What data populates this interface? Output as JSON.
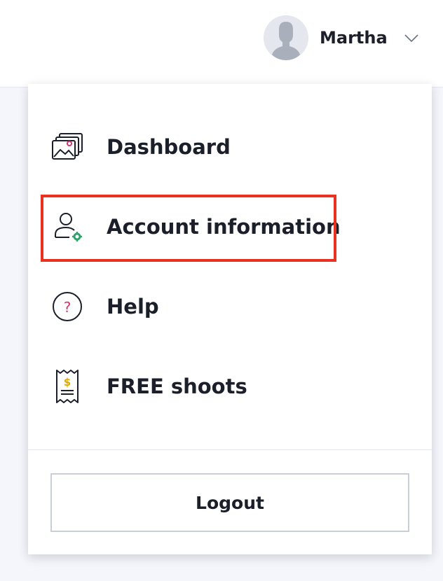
{
  "header": {
    "user_name": "Martha",
    "avatar_icon": "user-avatar-icon",
    "dropdown_icon": "chevron-down-icon"
  },
  "menu": {
    "items": [
      {
        "label": "Dashboard",
        "icon": "images-gallery-icon",
        "highlighted": false
      },
      {
        "label": "Account information",
        "icon": "user-settings-icon",
        "highlighted": true
      },
      {
        "label": "Help",
        "icon": "question-circle-icon",
        "highlighted": false
      },
      {
        "label": "FREE shoots",
        "icon": "receipt-dollar-icon",
        "highlighted": false
      }
    ],
    "logout_label": "Logout"
  },
  "colors": {
    "highlight_border": "#e8311e",
    "accent_pink": "#d6336c",
    "accent_green": "#2fa36b",
    "accent_gold": "#e0a800",
    "text": "#1b1f2a"
  }
}
